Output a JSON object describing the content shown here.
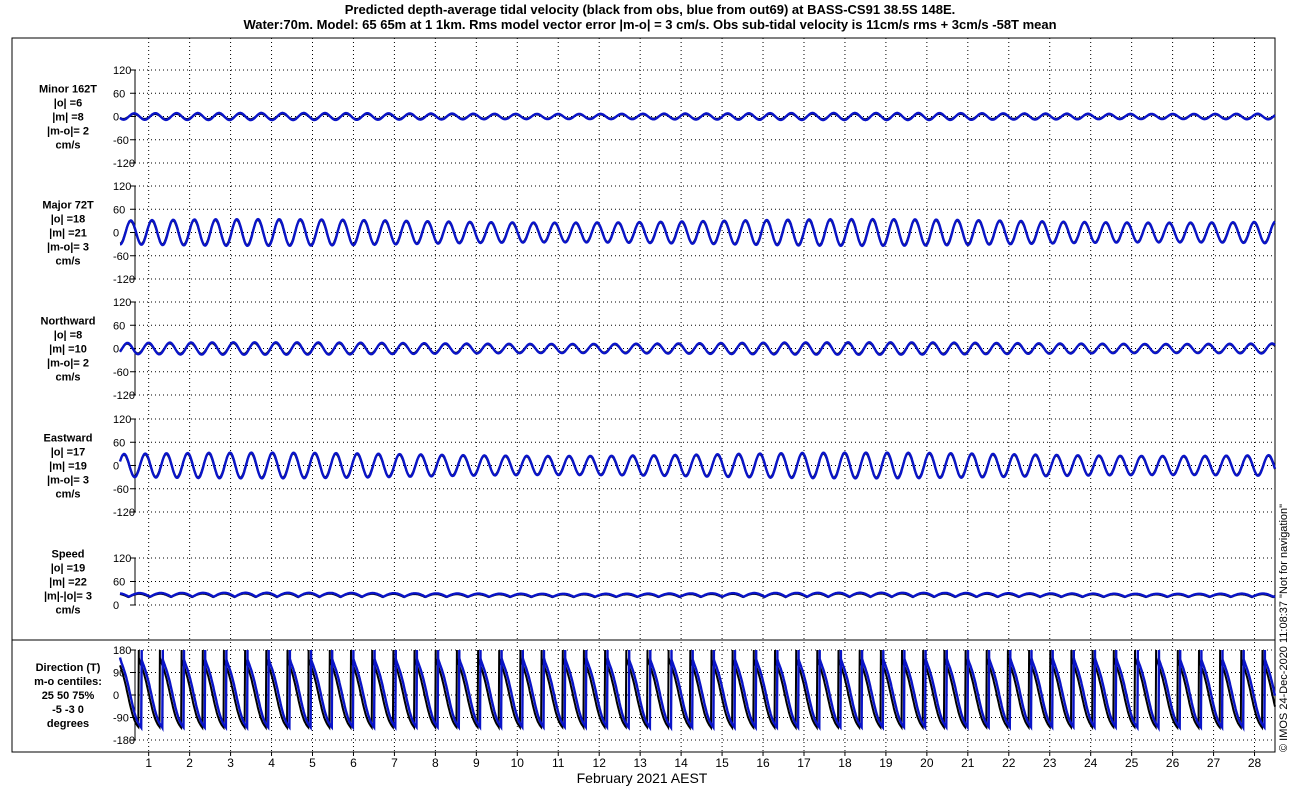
{
  "title_line1": "Predicted depth-average tidal velocity (black from obs, blue from out69) at BASS-CS91 38.5S 148E.",
  "title_line2": "Water:70m. Model: 65 65m at 1 1km. Rms model vector error |m-o| = 3 cm/s. Obs sub-tidal velocity is 11cm/s rms + 3cm/s -58T mean",
  "xlabel": "February 2021 AEST",
  "credit": "© IMOS 24-Dec-2020 11:08:37  \"Not for navigation\"",
  "colors": {
    "obs": "#000000",
    "model": "#0a14c8",
    "grid": "#000000"
  },
  "chart_data": [
    {
      "type": "line",
      "id": "minor",
      "panel_labels": [
        "Minor 162T",
        "|o| =6",
        "|m| =8",
        "|m-o|= 2",
        "cm/s"
      ],
      "ylim": [
        -120,
        120
      ],
      "yticks": [
        120,
        60,
        0,
        -60,
        -120
      ],
      "x_ticks": [
        1,
        2,
        3,
        4,
        5,
        6,
        7,
        8,
        9,
        10,
        11,
        12,
        13,
        14,
        15,
        16,
        17,
        18,
        19,
        20,
        21,
        22,
        23,
        24,
        25,
        26,
        27,
        28
      ],
      "xlim": [
        0.3,
        28.5
      ],
      "series": [
        {
          "role": "obs",
          "amplitude": 6,
          "mean": 0
        },
        {
          "role": "model",
          "amplitude": 8,
          "mean": 0
        }
      ]
    },
    {
      "type": "line",
      "id": "major",
      "panel_labels": [
        "Major 72T",
        "|o| =18",
        "|m| =21",
        "|m-o|= 3",
        "cm/s"
      ],
      "ylim": [
        -120,
        120
      ],
      "yticks": [
        120,
        60,
        0,
        -60,
        -120
      ],
      "xlim": [
        0.3,
        28.5
      ],
      "series": [
        {
          "role": "obs",
          "amplitude": 28,
          "mean": 0
        },
        {
          "role": "model",
          "amplitude": 30,
          "mean": 0
        }
      ]
    },
    {
      "type": "line",
      "id": "north",
      "panel_labels": [
        "Northward",
        "|o| =8",
        "|m| =10",
        "|m-o|= 2",
        "cm/s"
      ],
      "ylim": [
        -120,
        120
      ],
      "yticks": [
        120,
        60,
        0,
        -60,
        -120
      ],
      "xlim": [
        0.3,
        28.5
      ],
      "series": [
        {
          "role": "obs",
          "amplitude": 12,
          "mean": 0
        },
        {
          "role": "model",
          "amplitude": 14,
          "mean": 0
        }
      ]
    },
    {
      "type": "line",
      "id": "east",
      "panel_labels": [
        "Eastward",
        "|o| =17",
        "|m| =19",
        "|m-o|= 3",
        "cm/s"
      ],
      "ylim": [
        -120,
        120
      ],
      "yticks": [
        120,
        60,
        0,
        -60,
        -120
      ],
      "xlim": [
        0.3,
        28.5
      ],
      "series": [
        {
          "role": "obs",
          "amplitude": 27,
          "mean": 0
        },
        {
          "role": "model",
          "amplitude": 29,
          "mean": 0
        }
      ]
    },
    {
      "type": "line",
      "id": "speed",
      "panel_labels": [
        "Speed",
        "|o| =19",
        "|m| =22",
        "|m|-|o|= 3",
        "cm/s"
      ],
      "ylim": [
        0,
        120
      ],
      "yticks": [
        120,
        60,
        0
      ],
      "xlim": [
        0.3,
        28.5
      ],
      "series": [
        {
          "role": "obs",
          "amplitude": 8,
          "mean": 20
        },
        {
          "role": "model",
          "amplitude": 9,
          "mean": 21
        }
      ]
    },
    {
      "type": "line",
      "id": "direction",
      "panel_labels": [
        "Direction (T)",
        "m-o centiles:",
        "25  50  75%",
        "-5  -3   0",
        "degrees"
      ],
      "ylim": [
        -180,
        180
      ],
      "yticks": [
        180,
        90,
        0,
        -90,
        -180
      ],
      "xlim": [
        0.3,
        28.5
      ],
      "series": [
        {
          "role": "obs",
          "kind": "direction"
        },
        {
          "role": "model",
          "kind": "direction"
        }
      ]
    }
  ],
  "x_axis": {
    "ticks": [
      1,
      2,
      3,
      4,
      5,
      6,
      7,
      8,
      9,
      10,
      11,
      12,
      13,
      14,
      15,
      16,
      17,
      18,
      19,
      20,
      21,
      22,
      23,
      24,
      25,
      26,
      27,
      28
    ],
    "tick_labels": [
      "1",
      "2",
      "3",
      "4",
      "5",
      "6",
      "7",
      "8",
      "9",
      "10",
      "11",
      "12",
      "13",
      "14",
      "15",
      "16",
      "17",
      "18",
      "19",
      "20",
      "21",
      "22",
      "23",
      "24",
      "25",
      "26",
      "27",
      "28"
    ]
  }
}
